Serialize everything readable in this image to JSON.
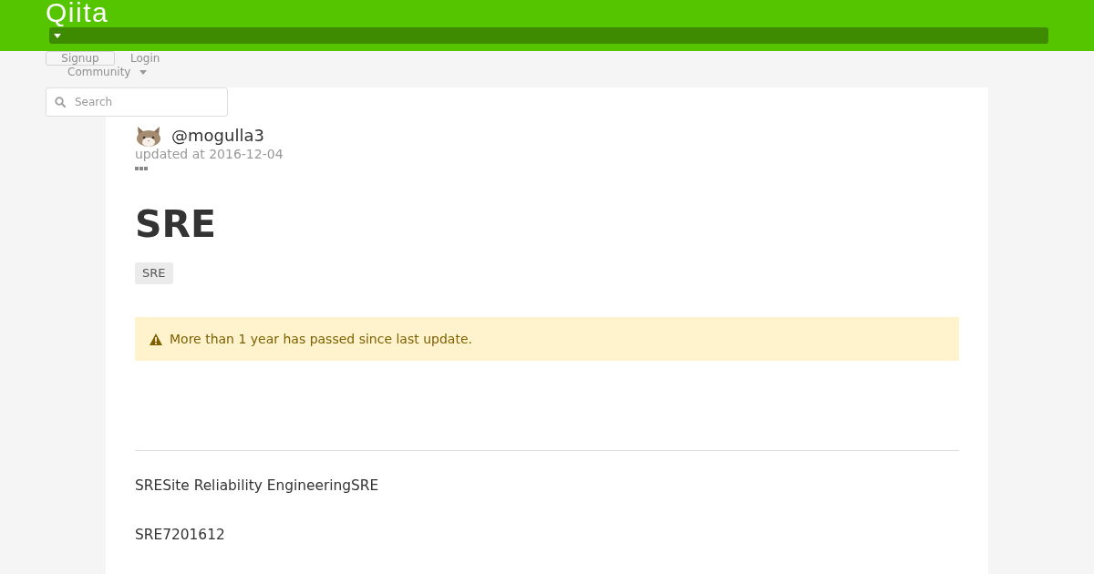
{
  "header": {
    "logo": "Qiita"
  },
  "account": {
    "signup": "Signup",
    "login": "Login",
    "community": "Community"
  },
  "search": {
    "placeholder": "Search"
  },
  "article": {
    "author": "@mogulla3",
    "updated": "updated at 2016-12-04",
    "title": "SRE",
    "tags": [
      {
        "label": "SRE"
      }
    ],
    "alert": {
      "kind": "warning",
      "text": "More than 1 year has passed since last update."
    },
    "paragraphs": [
      "SRESite Reliability EngineeringSRE",
      "SRE7201612"
    ]
  }
}
